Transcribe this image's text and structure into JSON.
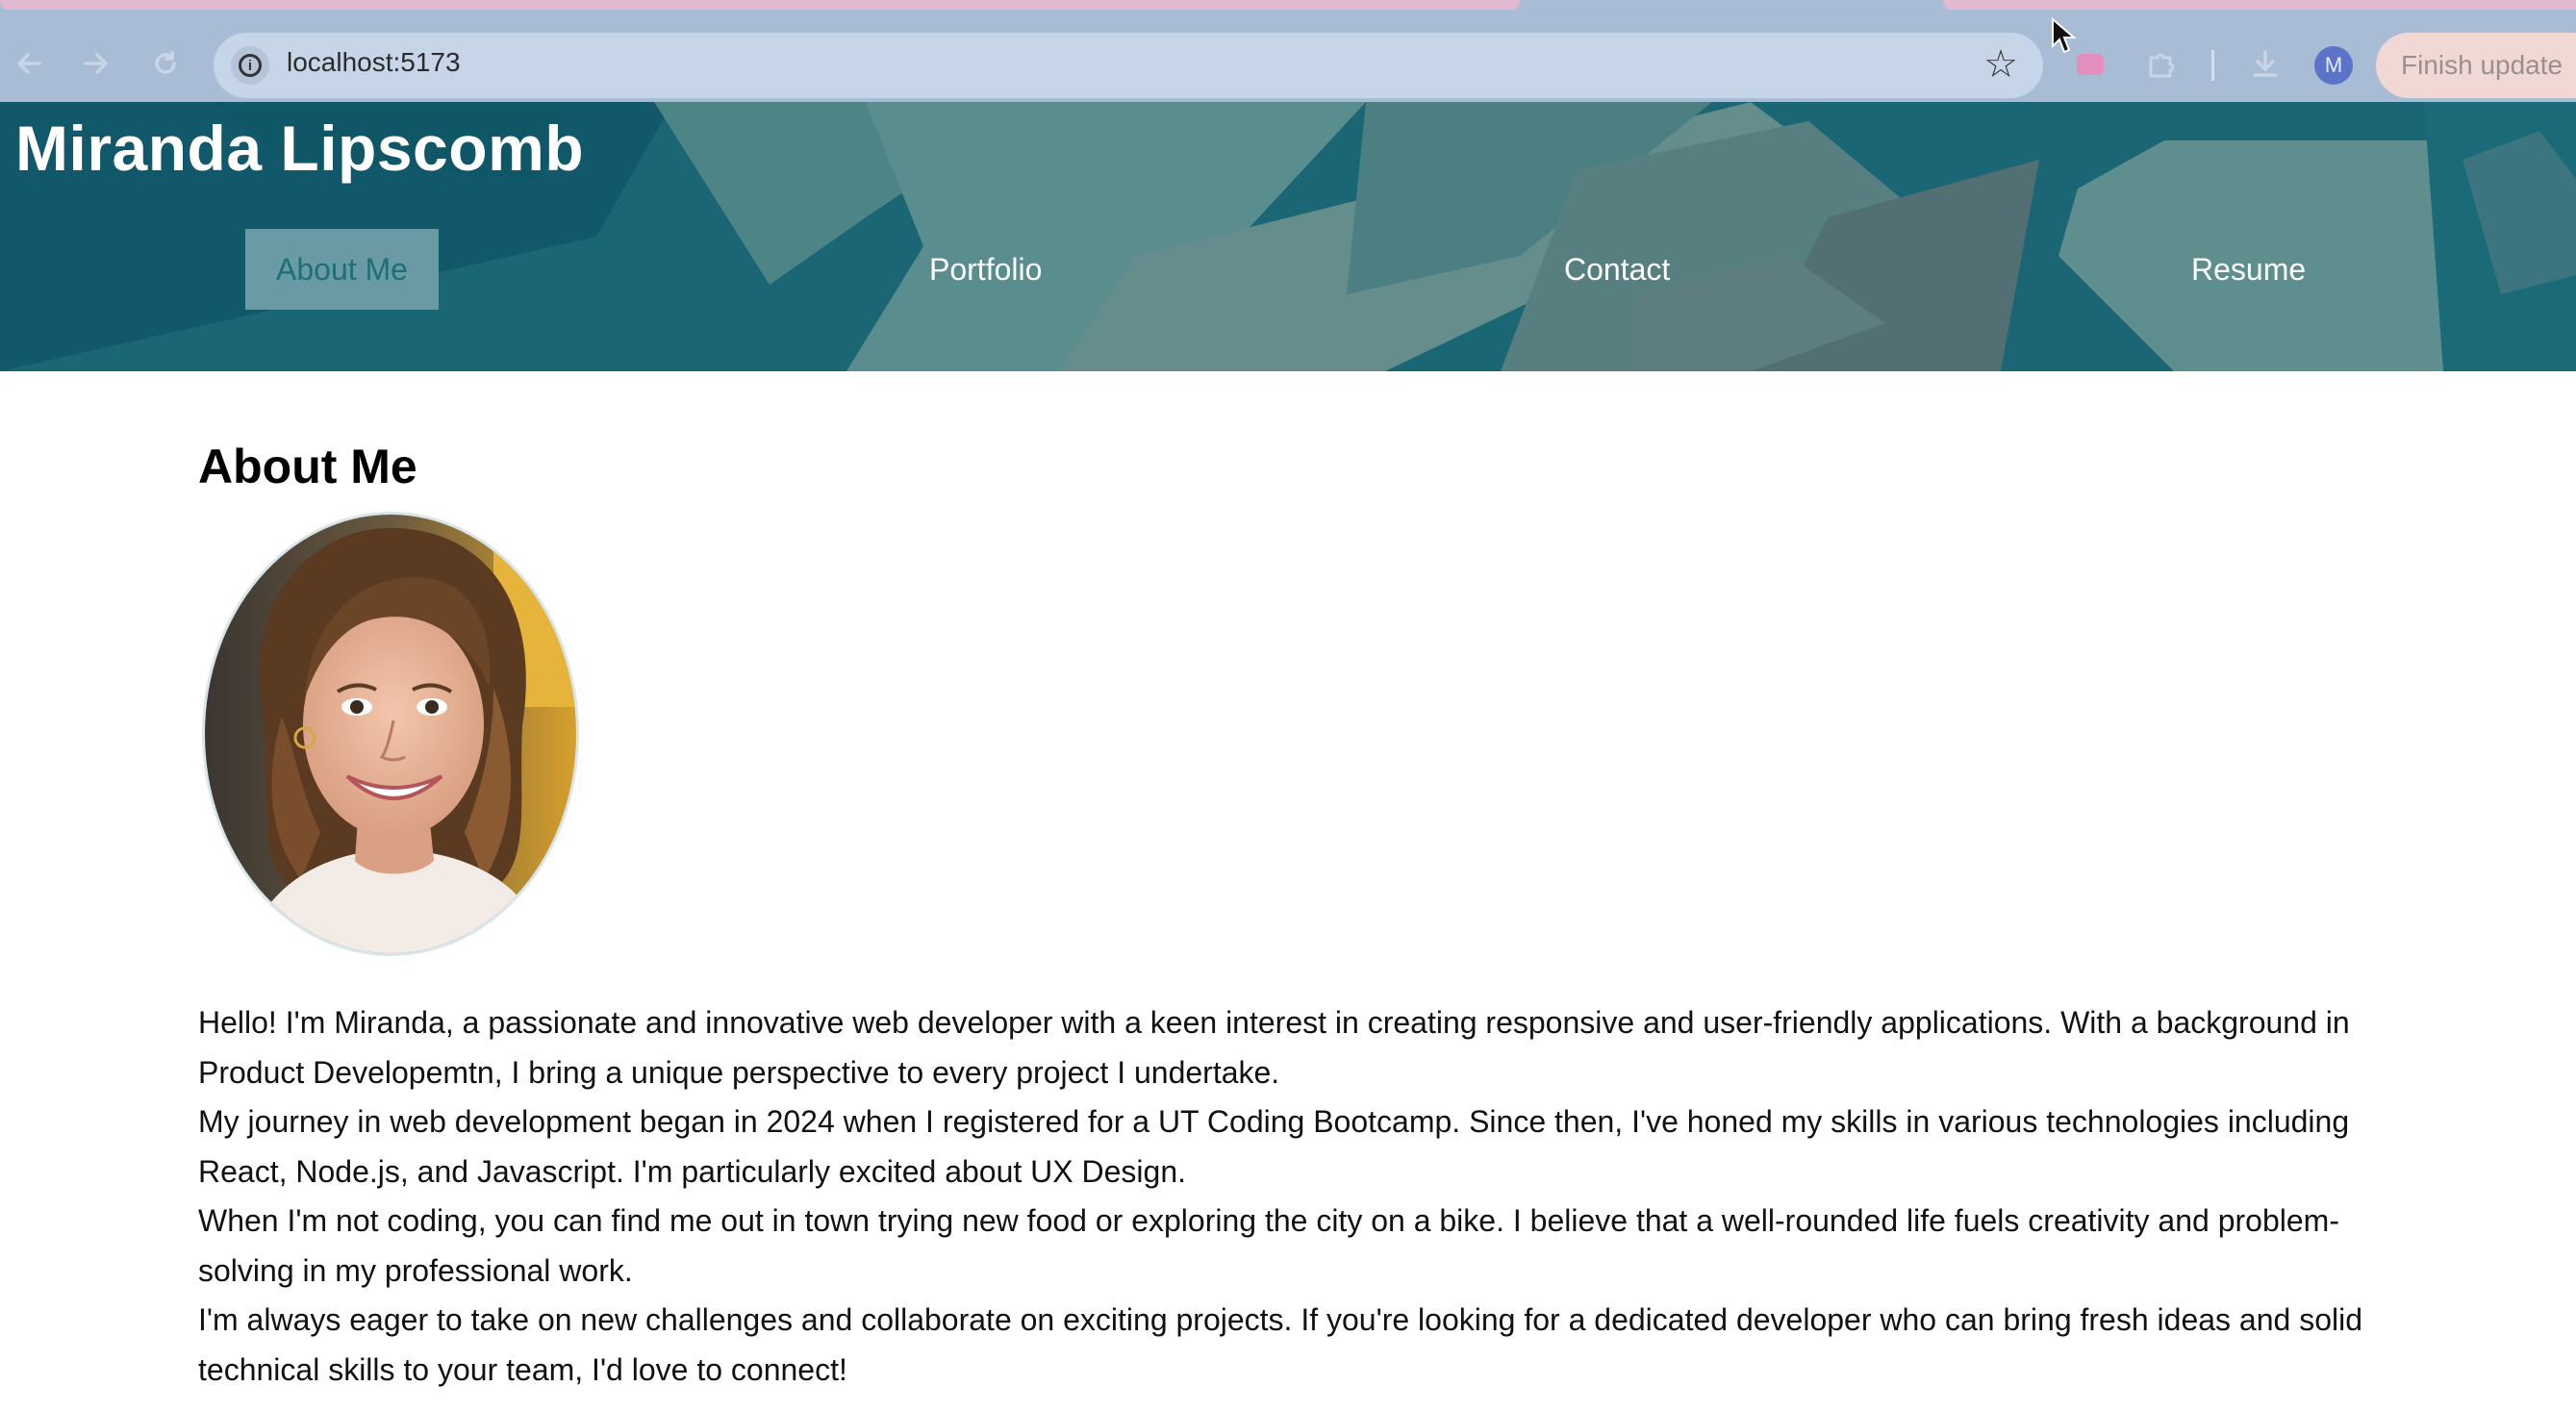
{
  "browser": {
    "url": "localhost:5173",
    "profile_initial": "M",
    "finish_update_label": "Finish update",
    "icons": [
      "back-icon",
      "forward-icon",
      "reload-icon",
      "site-info-icon",
      "bookmark-star-icon",
      "recording-icon",
      "extensions-icon",
      "downloads-icon"
    ]
  },
  "site": {
    "title": "Miranda Lipscomb",
    "nav": [
      {
        "label": "About Me",
        "active": true
      },
      {
        "label": "Portfolio",
        "active": false
      },
      {
        "label": "Contact",
        "active": false
      },
      {
        "label": "Resume",
        "active": false
      }
    ],
    "colors": {
      "header_teal": "#1d6b7b",
      "active_tab_bg": "#6a9aa3",
      "active_tab_text": "#1e6f78"
    }
  },
  "about": {
    "heading": "About Me",
    "paragraphs": [
      "Hello! I'm Miranda, a passionate and innovative web developer with a keen interest in creating responsive and user-friendly applications. With a background in Product Developemtn, I bring a unique perspective to every project I undertake.",
      "My journey in web development began in 2024 when I registered for a UT Coding Bootcamp. Since then, I've honed my skills in various technologies including React, Node.js, and Javascript. I'm particularly excited about UX Design.",
      "When I'm not coding, you can find me out in town trying new food or exploring the city on a bike. I believe that a well-rounded life fuels creativity and problem-solving in my professional work.",
      "I'm always eager to take on new challenges and collaborate on exciting projects. If you're looking for a dedicated developer who can bring fresh ideas and solid technical skills to your team, I'd love to connect!"
    ]
  }
}
